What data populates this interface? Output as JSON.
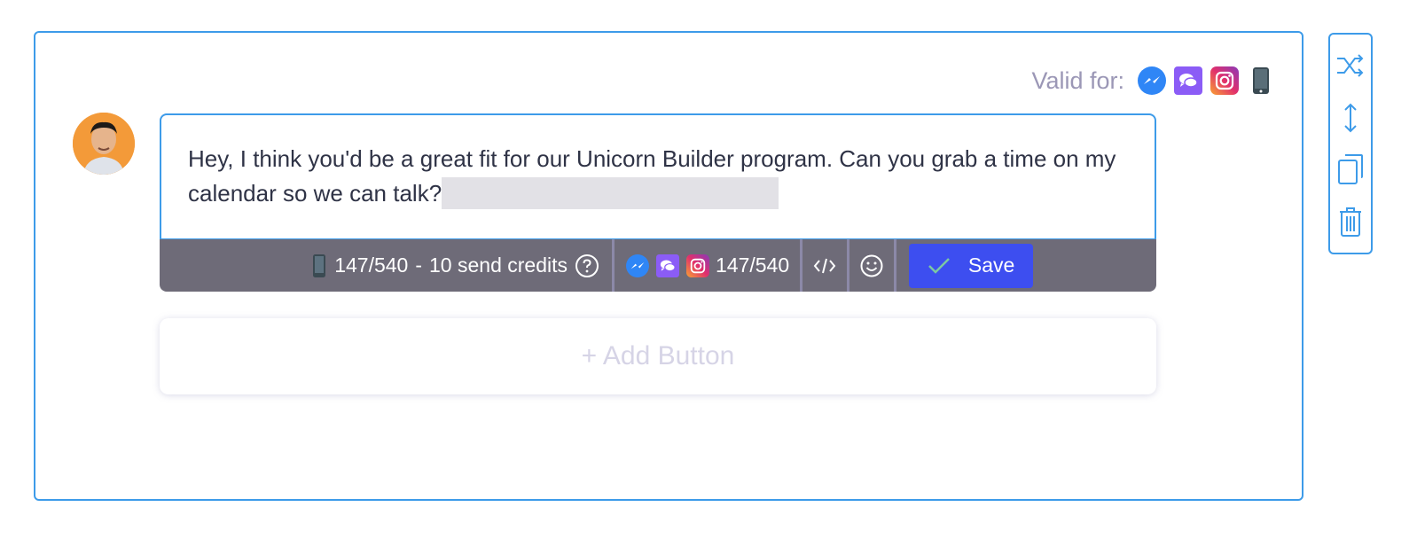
{
  "valid_for": {
    "label": "Valid for:",
    "channels": [
      "messenger-icon",
      "chat-bubble-icon",
      "instagram-icon",
      "phone-icon"
    ]
  },
  "message": {
    "text": "Hey, I think you'd be a great fit for our Unicorn Builder program. Can you grab a time on my calendar so we can talk?"
  },
  "toolbar": {
    "sms_count": "147/540",
    "separator": "-",
    "send_credits": "10 send credits",
    "chat_count": "147/540",
    "save_label": "Save"
  },
  "add_button": {
    "label": "+ Add Button"
  },
  "colors": {
    "accent_blue": "#3d9be9",
    "save_button": "#3d4ef0",
    "toolbar_bg": "#6e6b78",
    "messenger": "#2f86f6",
    "chat_purple": "#8b5cf6",
    "avatar_bg": "#f39a39"
  },
  "side_tools": [
    "shuffle-icon",
    "resize-vertical-icon",
    "copy-icon",
    "trash-icon"
  ]
}
